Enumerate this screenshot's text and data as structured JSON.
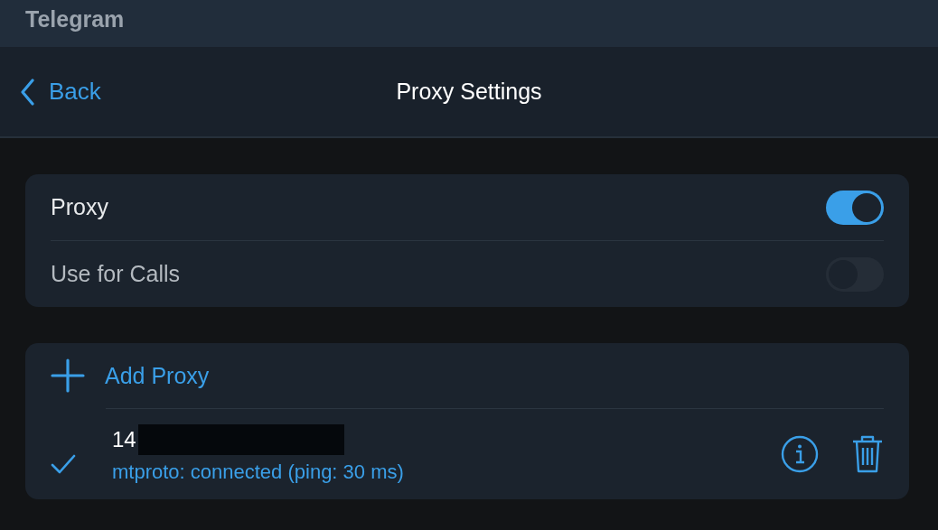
{
  "window": {
    "title": "Telegram"
  },
  "header": {
    "back": "Back",
    "title": "Proxy Settings"
  },
  "toggles": [
    {
      "label": "Proxy",
      "on": true,
      "disabled": false
    },
    {
      "label": "Use for Calls",
      "on": false,
      "disabled": true
    }
  ],
  "add_proxy": "Add Proxy",
  "proxies": [
    {
      "address": "14",
      "redacted": true,
      "status": "mtproto: connected (ping: 30 ms)",
      "selected": true
    }
  ]
}
